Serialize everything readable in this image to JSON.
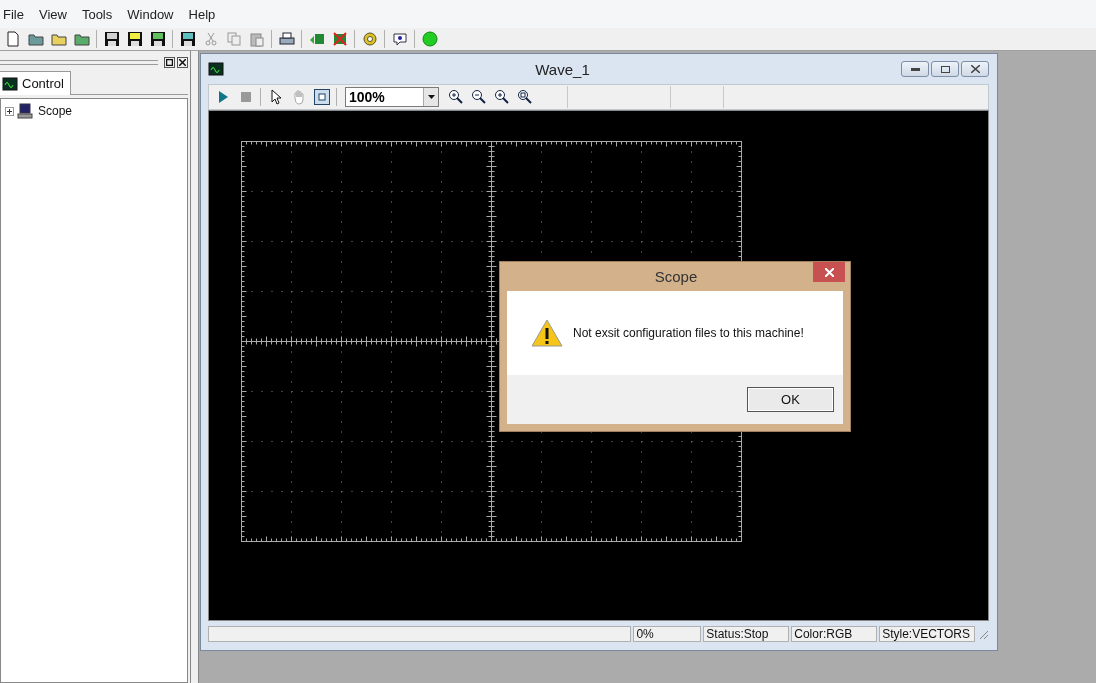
{
  "menu": [
    "File",
    "View",
    "Tools",
    "Window",
    "Help"
  ],
  "side_panel": {
    "tabs": [
      {
        "label": "Control",
        "selected": true
      }
    ],
    "tree": [
      {
        "label": "Scope",
        "expanded": false
      }
    ]
  },
  "wave_window": {
    "title": "Wave_1",
    "zoom": {
      "value": "100%"
    },
    "status_bar": [
      "0%",
      "Status:Stop",
      "Color:RGB",
      "Style:VECTORS"
    ]
  },
  "dialog": {
    "title": "Scope",
    "message": "Not exsit configuration files to this machine!",
    "buttons": [
      "OK"
    ]
  }
}
